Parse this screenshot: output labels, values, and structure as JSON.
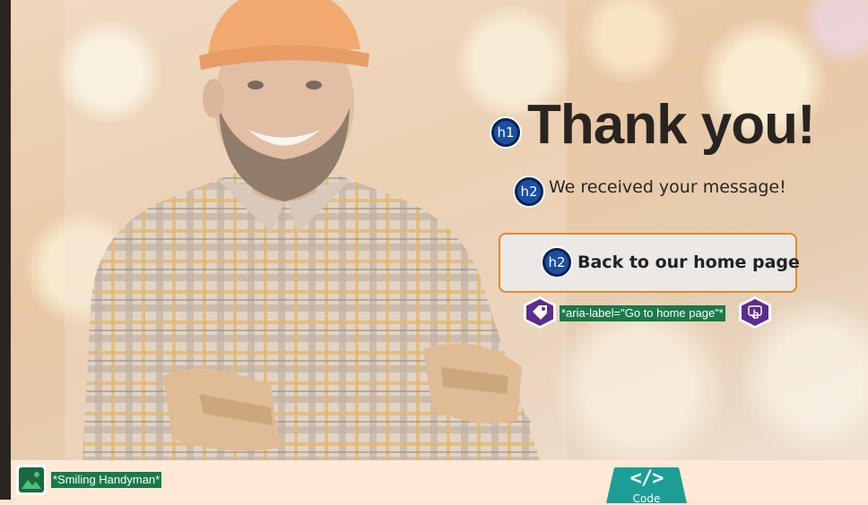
{
  "hero": {
    "image_alt": "*Smiling Handyman*"
  },
  "content": {
    "title": "Thank you!",
    "subtitle": "We received your message!",
    "home_button_label": "Back to our home page",
    "home_button_aria": "*aria-label=\"Go to home page\"*"
  },
  "annotations": {
    "h1_badge": "h1",
    "h2_badge": "h2",
    "h2_button_badge": "h2"
  },
  "toolbar": {
    "code_glyph": "</>",
    "code_label": "Code"
  },
  "colors": {
    "heading_badge": "#1b4fa2",
    "button_border": "#e08a2a",
    "aria_badge": "#5b2d8e",
    "alt_text_bg": "#1a7a48",
    "code_tab": "#1c9e97"
  },
  "icons": {
    "heading_badges": "heading-level-icon",
    "aria_tag": "tag-icon",
    "touch": "tap-icon",
    "image": "image-icon",
    "code": "code-icon"
  }
}
